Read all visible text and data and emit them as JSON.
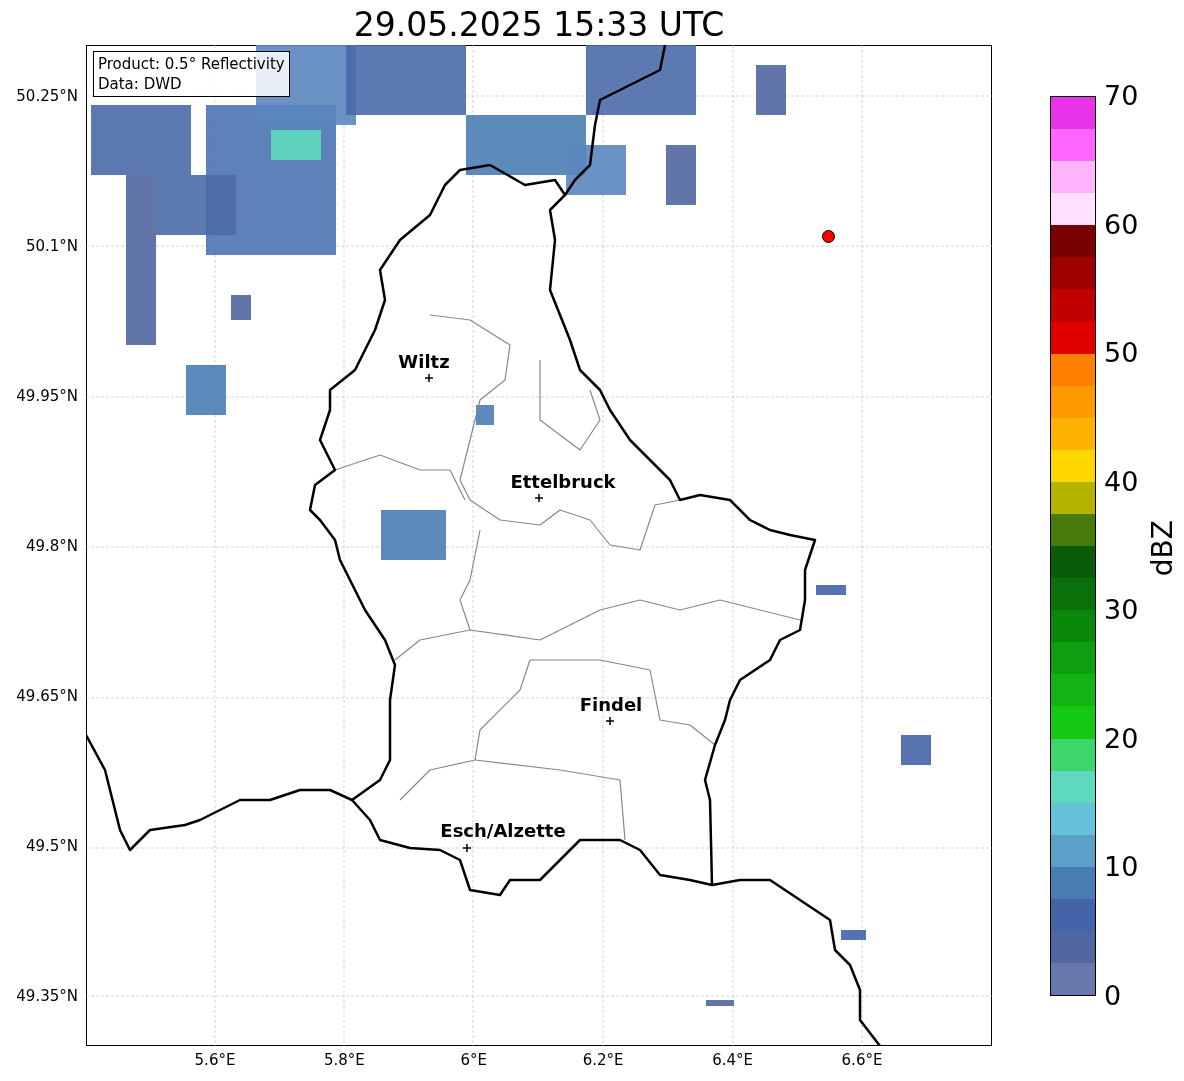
{
  "title": "29.05.2025 15:33 UTC",
  "info_box": {
    "lines": [
      "Product: 0.5° Reflectivity",
      "Data: DWD"
    ]
  },
  "map": {
    "latitude_labels": [
      "50.25°N",
      "50.1°N",
      "49.95°N",
      "49.8°N",
      "49.65°N",
      "49.5°N",
      "49.35°N"
    ],
    "longitude_labels": [
      "5.6°E",
      "5.8°E",
      "6°E",
      "6.2°E",
      "6.4°E",
      "6.6°E"
    ],
    "cities": [
      {
        "name": "Wiltz"
      },
      {
        "name": "Ettelbruck"
      },
      {
        "name": "Findel"
      },
      {
        "name": "Esch/Alzette"
      }
    ]
  },
  "colorbar": {
    "label": "dBZ",
    "ticks": [
      "70",
      "60",
      "50",
      "40",
      "30",
      "20",
      "10",
      "0"
    ],
    "segments": [
      {
        "color": "#e833e8"
      },
      {
        "color": "#ff66ff"
      },
      {
        "color": "#ffb3ff"
      },
      {
        "color": "#ffe0ff"
      },
      {
        "color": "#7a0000"
      },
      {
        "color": "#9e0000"
      },
      {
        "color": "#c00000"
      },
      {
        "color": "#e00000"
      },
      {
        "color": "#ff8000"
      },
      {
        "color": "#ff9900"
      },
      {
        "color": "#ffb300"
      },
      {
        "color": "#ffd700"
      },
      {
        "color": "#b3b300"
      },
      {
        "color": "#4a7a0a"
      },
      {
        "color": "#0a5c0a"
      },
      {
        "color": "#0a700a"
      },
      {
        "color": "#0a880a"
      },
      {
        "color": "#0f9e0f"
      },
      {
        "color": "#12b312"
      },
      {
        "color": "#14c814"
      },
      {
        "color": "#3dd66b"
      },
      {
        "color": "#5ed9c0"
      },
      {
        "color": "#66c2d9"
      },
      {
        "color": "#5aa0c8"
      },
      {
        "color": "#4a7db3"
      },
      {
        "color": "#4464a8"
      },
      {
        "color": "#5066a0"
      },
      {
        "color": "#6677aa"
      }
    ]
  }
}
